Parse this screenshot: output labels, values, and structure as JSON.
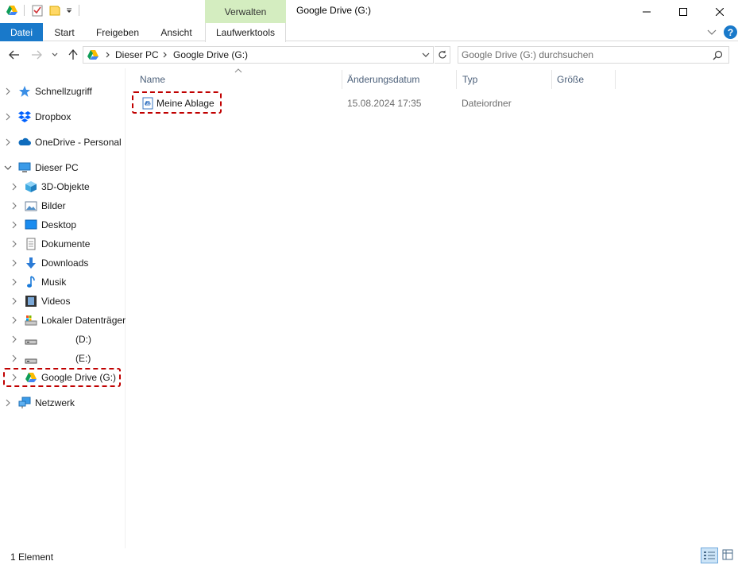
{
  "window": {
    "title": "Google Drive (G:)",
    "context_tab": "Verwalten"
  },
  "ribbon": {
    "tabs": [
      "Datei",
      "Start",
      "Freigeben",
      "Ansicht",
      "Laufwerktools"
    ],
    "help": "?"
  },
  "address": {
    "path": [
      "Dieser PC",
      "Google Drive (G:)"
    ]
  },
  "search": {
    "placeholder": "Google Drive (G:) durchsuchen"
  },
  "nav": {
    "items": [
      {
        "label": "Schnellzugriff",
        "icon": "star-icon"
      },
      {
        "label": "Dropbox",
        "icon": "dropbox-icon"
      },
      {
        "label": "OneDrive - Personal",
        "icon": "cloud-icon"
      },
      {
        "label": "Dieser PC",
        "icon": "computer-icon"
      },
      {
        "label": "3D-Objekte",
        "icon": "cube-icon"
      },
      {
        "label": "Bilder",
        "icon": "pictures-icon"
      },
      {
        "label": "Desktop",
        "icon": "desktop-icon"
      },
      {
        "label": "Dokumente",
        "icon": "documents-icon"
      },
      {
        "label": "Downloads",
        "icon": "download-icon"
      },
      {
        "label": "Musik",
        "icon": "music-icon"
      },
      {
        "label": "Videos",
        "icon": "video-icon"
      },
      {
        "label": "Lokaler Datenträger",
        "icon": "drive-icon"
      },
      {
        "label": "(D:)",
        "icon": "drive-icon"
      },
      {
        "label": "(E:)",
        "icon": "drive-icon"
      },
      {
        "label": "Google Drive (G:)",
        "icon": "google-drive-icon"
      },
      {
        "label": "Netzwerk",
        "icon": "network-icon"
      }
    ]
  },
  "columns": {
    "name": "Name",
    "date": "Änderungsdatum",
    "type": "Typ",
    "size": "Größe"
  },
  "files": [
    {
      "name": "Meine Ablage",
      "date": "15.08.2024 17:35",
      "type": "Dateiordner",
      "size": ""
    }
  ],
  "status": {
    "count": "1 Element"
  },
  "colors": {
    "accent": "#1979ca",
    "context_tab": "#d4edc0",
    "highlight_dash": "#c00000"
  }
}
